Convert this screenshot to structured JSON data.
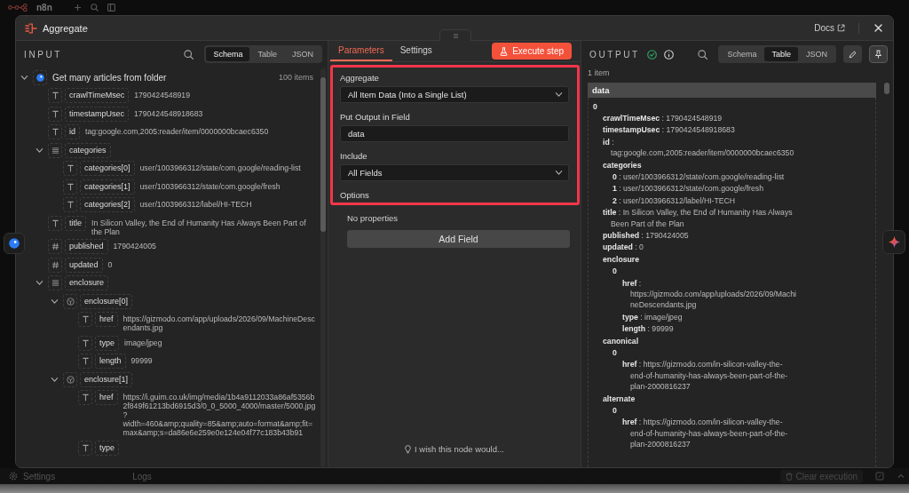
{
  "background_app": {
    "logo_text": "n8n",
    "settings_label": "Settings",
    "logs_label": "Logs",
    "clear_button": "Clear execution"
  },
  "modal": {
    "title": "Aggregate",
    "docs_link": "Docs"
  },
  "input_panel": {
    "heading": "INPUT",
    "view_tabs": [
      {
        "label": "Schema",
        "selected": true
      },
      {
        "label": "Table",
        "selected": false
      },
      {
        "label": "JSON",
        "selected": false
      }
    ],
    "tree": [
      {
        "kind": "source",
        "key": "Get many articles from folder",
        "count": "100 items",
        "expanded": true,
        "children": [
          {
            "kind": "string",
            "key": "crawlTimeMsec",
            "value": "1790424548919"
          },
          {
            "kind": "string",
            "key": "timestampUsec",
            "value": "1790424548918683"
          },
          {
            "kind": "string",
            "key": "id",
            "value": "tag:google.com,2005:reader/item/0000000bcaec6350"
          },
          {
            "kind": "array",
            "key": "categories",
            "expanded": true,
            "children": [
              {
                "kind": "string",
                "key": "categories[0]",
                "value": "user/1003966312/state/com.google/reading-list"
              },
              {
                "kind": "string",
                "key": "categories[1]",
                "value": "user/1003966312/state/com.google/fresh"
              },
              {
                "kind": "string",
                "key": "categories[2]",
                "value": "user/1003966312/label/HI-TECH"
              }
            ]
          },
          {
            "kind": "string",
            "key": "title",
            "value": "In Silicon Valley, the End of Humanity Has Always Been Part of the Plan"
          },
          {
            "kind": "number",
            "key": "published",
            "value": "1790424005"
          },
          {
            "kind": "number",
            "key": "updated",
            "value": "0"
          },
          {
            "kind": "array",
            "key": "enclosure",
            "expanded": true,
            "children": [
              {
                "kind": "object",
                "key": "enclosure[0]",
                "expanded": true,
                "children": [
                  {
                    "kind": "string",
                    "key": "href",
                    "value": "https://gizmodo.com/app/uploads/2026/09/MachineDescendants.jpg"
                  },
                  {
                    "kind": "string",
                    "key": "type",
                    "value": "image/jpeg"
                  },
                  {
                    "kind": "string",
                    "key": "length",
                    "value": "99999"
                  }
                ]
              },
              {
                "kind": "object",
                "key": "enclosure[1]",
                "expanded": true,
                "children": [
                  {
                    "kind": "string",
                    "key": "href",
                    "value": "https://i.guim.co.uk/img/media/1b4a9112033a86af5356b2f849f61213bd6915d3/0_0_5000_4000/master/5000.jpg?width=460&amp;quality=85&amp;auto=format&amp;fit=max&amp;s=da86e6e259e0e124e04f77c183b43b91"
                  },
                  {
                    "kind": "string",
                    "key": "type"
                  }
                ]
              }
            ]
          }
        ]
      }
    ]
  },
  "parameters_panel": {
    "tabs": [
      {
        "label": "Parameters",
        "selected": true
      },
      {
        "label": "Settings",
        "selected": false
      }
    ],
    "execute_button": "Execute step",
    "highlighted": true,
    "fields": [
      {
        "kind": "select",
        "label": "Aggregate",
        "value": "All Item Data (Into a Single List)"
      },
      {
        "kind": "input",
        "label": "Put Output in Field",
        "value": "data"
      },
      {
        "kind": "select",
        "label": "Include",
        "value": "All Fields"
      }
    ],
    "options": {
      "heading": "Options",
      "empty_text": "No properties",
      "add_button": "Add Field"
    },
    "feedback_link": "I wish this node would..."
  },
  "output_panel": {
    "heading": "OUTPUT",
    "run_succeeded": true,
    "view_tabs": [
      {
        "label": "Schema",
        "selected": false
      },
      {
        "label": "Table",
        "selected": true
      },
      {
        "label": "JSON",
        "selected": false
      }
    ],
    "item_count": "1 item",
    "table": {
      "column": "data",
      "rows": [
        {
          "kind": "group",
          "text": "0",
          "children": [
            {
              "kind": "pair",
              "text": "**crawlTimeMsec** : 1790424548919"
            },
            {
              "kind": "pair",
              "text": "**timestampUsec** : 1790424548918683"
            },
            {
              "kind": "pair",
              "text": "**id** : tag:google.com,2005:reader/item/0000000bcaec6350"
            },
            {
              "kind": "group",
              "text": "categories",
              "children": [
                {
                  "kind": "pair",
                  "text": "**0** : user/1003966312/state/com.google/reading-list"
                },
                {
                  "kind": "pair",
                  "text": "**1** : user/1003966312/state/com.google/fresh"
                },
                {
                  "kind": "pair",
                  "text": "**2** : user/1003966312/label/HI-TECH"
                }
              ]
            },
            {
              "kind": "pair",
              "text": "**title** : In Silicon Valley, the End of Humanity Has Always Been Part of the Plan"
            },
            {
              "kind": "pair",
              "text": "**published** : 1790424005"
            },
            {
              "kind": "pair",
              "text": "**updated** : 0"
            },
            {
              "kind": "group",
              "text": "enclosure",
              "children": [
                {
                  "kind": "group",
                  "text": "0",
                  "children": [
                    {
                      "kind": "pair",
                      "text": "**href** : https://gizmodo.com/app/uploads/2026/09/MachineDescendants.jpg"
                    },
                    {
                      "kind": "pair",
                      "text": "**type** : image/jpeg"
                    },
                    {
                      "kind": "pair",
                      "text": "**length** : 99999"
                    }
                  ]
                }
              ]
            },
            {
              "kind": "group",
              "text": "canonical",
              "children": [
                {
                  "kind": "group",
                  "text": "0",
                  "children": [
                    {
                      "kind": "pair",
                      "text": "**href** : https://gizmodo.com/in-silicon-valley-the-end-of-humanity-has-always-been-part-of-the-plan-2000816237"
                    }
                  ]
                }
              ]
            },
            {
              "kind": "group",
              "text": "alternate",
              "children": [
                {
                  "kind": "group",
                  "text": "0",
                  "children": [
                    {
                      "kind": "pair",
                      "text": "**href** : https://gizmodo.com/in-silicon-valley-the-end-of-humanity-has-always-been-part-of-the-plan-2000816237"
                    }
                  ]
                }
              ]
            }
          ]
        }
      ]
    }
  }
}
